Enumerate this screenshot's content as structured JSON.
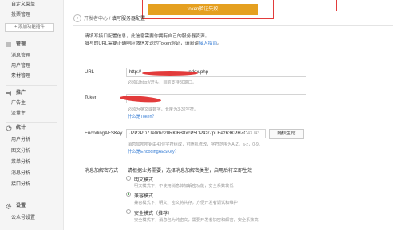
{
  "sidebar": {
    "items_top": [
      "自定义菜单",
      "投票管理"
    ],
    "add_plugin": "+ 添加功能插件",
    "groups": [
      {
        "title": "管理",
        "icon": "list-icon",
        "items": [
          "消息管理",
          "用户管理",
          "素材管理"
        ]
      },
      {
        "title": "推广",
        "icon": "megaphone-icon",
        "items": [
          "广告主",
          "流量主"
        ]
      },
      {
        "title": "统计",
        "icon": "chart-icon",
        "items": [
          "用户分析",
          "图文分析",
          "菜单分析",
          "消息分析",
          "接口分析"
        ]
      },
      {
        "title": "设置",
        "icon": "gear-icon",
        "items": [
          "公众号设置"
        ]
      }
    ]
  },
  "top": {
    "verify_button": "token验证失败"
  },
  "breadcrumb": {
    "parent": "开发者中心",
    "separator": " / ",
    "current": "填写服务器配置"
  },
  "intro": {
    "line1": "请填写接口配置信息，此信息需要你拥有自己的服务器资源。",
    "line2": "填写的URL需要正确响应微信发送的Token验证，请阅读",
    "link": "接入指南",
    "end": "。"
  },
  "form": {
    "url": {
      "label": "URL",
      "value_prefix": "http://",
      "value_suffix": "index.php",
      "hint": "必须以http://开头，目前支持80端口。"
    },
    "token": {
      "label": "Token",
      "hint": "必须为英文或数字，长度为3-32字符。",
      "link": "什么是Token？"
    },
    "aeskey": {
      "label": "EncodingAESKey",
      "value": "J2P2PD7Te0rhc20RKl6B8xcP5DP4zr7pLEez63KPHZC",
      "counter": "43 /43",
      "random_button": "随机生成",
      "hint": "消息加密密钥由43位字符组成，可随机修改，字符范围为A-Z，a-z，0-9。",
      "link": "什么是EncodingAESKey？"
    },
    "encryption": {
      "label": "消息加解密方式",
      "intro": "请根据业务需要，选择消息加解密类型，启用后将立即生效",
      "options": [
        {
          "label": "明文模式",
          "desc": "明文模式下，不使用消息体加解密功能，安全系数较低",
          "selected": false
        },
        {
          "label": "兼容模式",
          "desc": "兼容模式下，明文、密文将共存，方便开发者调试和维护",
          "selected": true
        },
        {
          "label": "安全模式（推荐）",
          "desc": "安全模式下，消息包为纯密文，需要开发者加密和解密，安全系数高",
          "selected": false
        }
      ]
    }
  },
  "colors": {
    "accent": "#e5a020",
    "link": "#3a7fd5",
    "redaction": "#e23b3b",
    "sidebar_bg": "#f5f5f5"
  }
}
